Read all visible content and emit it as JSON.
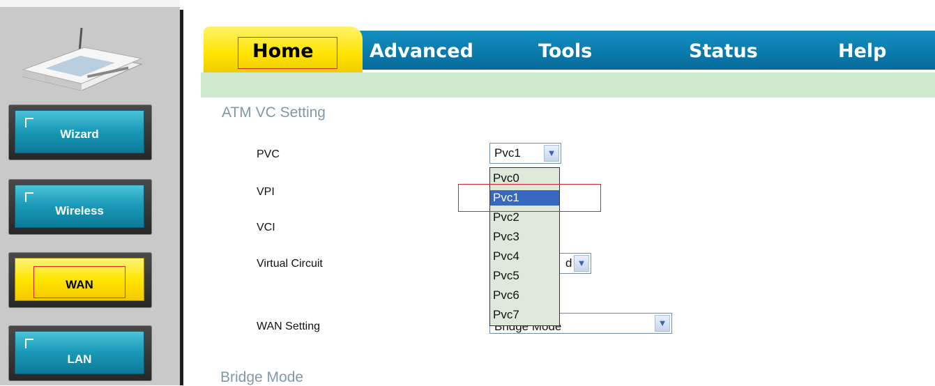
{
  "sidebar": {
    "nav": [
      {
        "label": "Wizard",
        "active": false
      },
      {
        "label": "Wireless",
        "active": false
      },
      {
        "label": "WAN",
        "active": true
      },
      {
        "label": "LAN",
        "active": false
      }
    ]
  },
  "tabs": [
    {
      "label": "Home",
      "active": true
    },
    {
      "label": "Advanced",
      "active": false
    },
    {
      "label": "Tools",
      "active": false
    },
    {
      "label": "Status",
      "active": false
    },
    {
      "label": "Help",
      "active": false
    }
  ],
  "main": {
    "section_title": "ATM VC Setting",
    "fields": {
      "pvc_label": "PVC",
      "vpi_label": "VPI",
      "vci_label": "VCI",
      "virtual_circuit_label": "Virtual Circuit",
      "wan_setting_label": "WAN Setting"
    },
    "pvc_value": "Pvc1",
    "pvc_options": [
      "Pvc0",
      "Pvc1",
      "Pvc2",
      "Pvc3",
      "Pvc4",
      "Pvc5",
      "Pvc6",
      "Pvc7"
    ],
    "pvc_highlighted": "Pvc1",
    "virtual_circuit_partial": "d",
    "wan_setting_value": "Bridge Mode",
    "next_section_title": "Bridge Mode"
  },
  "colors": {
    "accent_blue": "#0a79aa",
    "active_yellow": "#ffe600",
    "highlight_red": "#d8262a",
    "selection_blue": "#3768c0",
    "subbar_green": "#d0ead0"
  },
  "icons": [
    "router-icon",
    "chevron-down-icon"
  ]
}
